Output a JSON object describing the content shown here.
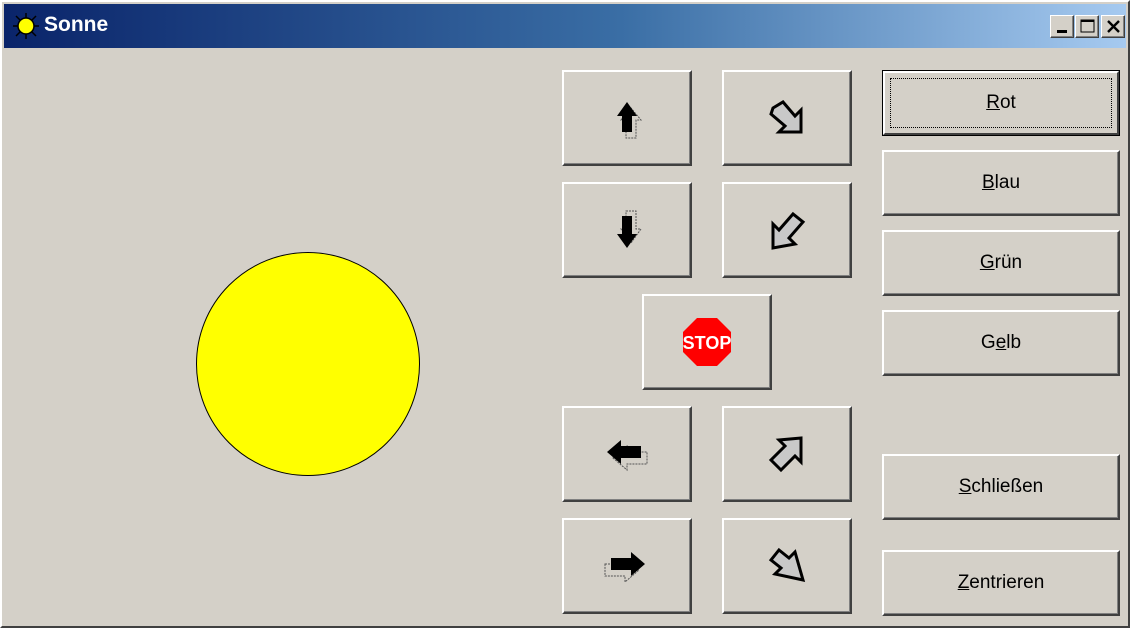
{
  "window": {
    "title": "Sonne",
    "controls": [
      "minimize-icon",
      "maximize-icon",
      "close-icon"
    ],
    "background": "#d4d0c8",
    "title_gradient": [
      "#0a246a",
      "#a6caf0"
    ]
  },
  "sun": {
    "color": "#ffff00"
  },
  "arrow_buttons": [
    {
      "name": "move-up-button",
      "icon": "arrow-up-icon"
    },
    {
      "name": "rotate-right-up-button",
      "icon": "arrow-diagonal-down-right-icon"
    },
    {
      "name": "move-down-button",
      "icon": "arrow-down-icon"
    },
    {
      "name": "rotate-left-up-button",
      "icon": "arrow-diagonal-up-right-icon"
    },
    {
      "name": "stop-button",
      "icon": "stop-sign-icon",
      "label": "STOP"
    },
    {
      "name": "move-left-button",
      "icon": "arrow-left-icon"
    },
    {
      "name": "rotate-up-left-button",
      "icon": "arrow-diagonal-up-left-icon"
    },
    {
      "name": "move-right-button",
      "icon": "arrow-right-icon"
    },
    {
      "name": "rotate-down-left-button",
      "icon": "arrow-diagonal-down-left-icon"
    }
  ],
  "buttons": {
    "rot": {
      "mnemonic": "R",
      "rest": "ot"
    },
    "blau": {
      "mnemonic": "B",
      "rest": "lau"
    },
    "gruen": {
      "mnemonic": "G",
      "rest": "rün"
    },
    "gelb": {
      "pre": "G",
      "mnemonic": "e",
      "rest": "lb"
    },
    "schliessen": {
      "mnemonic": "S",
      "rest": "chließen"
    },
    "zentrieren": {
      "mnemonic": "Z",
      "rest": "entrieren"
    }
  }
}
